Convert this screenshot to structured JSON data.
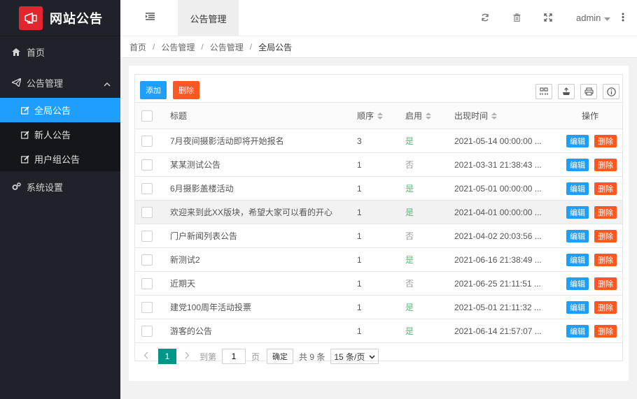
{
  "sidebar": {
    "brand": "网站公告",
    "items": [
      {
        "label": "首页"
      },
      {
        "label": "公告管理"
      },
      {
        "label": "系统设置"
      }
    ],
    "sub_items": [
      {
        "label": "全局公告"
      },
      {
        "label": "新人公告"
      },
      {
        "label": "用户组公告"
      }
    ]
  },
  "header": {
    "tab": "公告管理",
    "user": "admin"
  },
  "breadcrumb": [
    "首页",
    "公告管理",
    "公告管理",
    "全局公告"
  ],
  "toolbar": {
    "add": "添加",
    "delete": "删除"
  },
  "table": {
    "columns": [
      "标题",
      "顺序",
      "启用",
      "出现时间",
      "操作"
    ],
    "rows": [
      {
        "title": "7月夜间摄影活动即将开始报名",
        "order": "3",
        "enabled": "是",
        "time": "2021-05-14 00:00:00 ..."
      },
      {
        "title": "某某测试公告",
        "order": "1",
        "enabled": "否",
        "time": "2021-03-31 21:38:43 ..."
      },
      {
        "title": "6月摄影盖楼活动",
        "order": "1",
        "enabled": "是",
        "time": "2021-05-01 00:00:00 ..."
      },
      {
        "title": "欢迎来到此XX版块，希望大家可以看的开心",
        "order": "1",
        "enabled": "是",
        "time": "2021-04-01 00:00:00 ..."
      },
      {
        "title": "门户新闻列表公告",
        "order": "1",
        "enabled": "否",
        "time": "2021-04-02 20:03:56 ..."
      },
      {
        "title": "新测试2",
        "order": "1",
        "enabled": "是",
        "time": "2021-06-16 21:38:49 ..."
      },
      {
        "title": "近期天",
        "order": "1",
        "enabled": "否",
        "time": "2021-06-25 21:11:51 ..."
      },
      {
        "title": "建党100周年活动投票",
        "order": "1",
        "enabled": "是",
        "time": "2021-05-01 21:11:32 ..."
      },
      {
        "title": "游客的公告",
        "order": "1",
        "enabled": "是",
        "time": "2021-06-14 21:57:07 ..."
      }
    ],
    "edit_label": "编辑",
    "delete_label": "删除"
  },
  "pager": {
    "current": "1",
    "goto_label": "到第",
    "page_value": "1",
    "page_unit": "页",
    "confirm": "确定",
    "total": "共 9 条",
    "per_page": "15 条/页"
  }
}
